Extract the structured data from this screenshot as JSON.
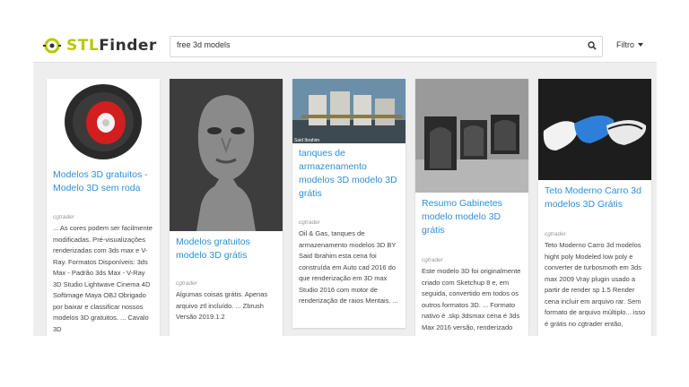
{
  "header": {
    "logo_prefix": "STL",
    "logo_suffix": "Finder",
    "search_value": "free 3d models",
    "filter_label": "Filtro"
  },
  "results": [
    {
      "title": "Modelos 3D gratuitos - Modelo 3D sem roda",
      "source": "cgtrader",
      "description": "... As cores podem ser facilmente modificadas. Pré-visualizações renderizadas com 3ds max e V-Ray. Formatos Disponíveis: 3ds Max - Padrão 3ds Max - V-Ray 3D Studio Lightwave Cinema 4D Softimage Maya OBJ Obrigado por baixar e classificar nossos modelos 3D gratuitos. ... Cavalo 3D"
    },
    {
      "title": "Modelos gratuitos modelo 3D grátis",
      "source": "cgtrader",
      "description": "Algumas coisas grátis. Apenas arquivo ztl incluído. ... Zbrush Versão 2019.1.2"
    },
    {
      "title": "tanques de armazenamento modelos 3D modelo 3D grátis",
      "source": "cgtrader",
      "image_caption": "Said Ibrahim",
      "description": "Oil & Gas, tanques de armazenamento modelos 3D BY Said Ibrahim esta cena foi construída em Auto cad 2016 do que renderização em 3D max Studio 2016 com motor de renderização de raios Mentais. ..."
    },
    {
      "title": "Resumo Gabinetes modelo modelo 3D grátis",
      "source": "cgtrader",
      "description": "Este modelo 3D foi originalmente criado com Sketchup 8 e, em seguida, convertido em todos os outros formatos 3D. ... Formato nativo é .skp 3dsmax cena é 3ds Max 2016 versão, renderizado com"
    },
    {
      "title": "Teto Moderno Carro 3d modelos 3D Grátis",
      "source": "cgtrader",
      "description": "Teto Moderno Carro 3d modelos hight poly Modeled low poly e converter de turbosmoth em 3ds max 2009 Vray plugin usado a partir de render sp 1.5 Render cena incluir em arquivo rar. Sem formato de arquivo múltiplo... isso é grátis no cgtrader então,"
    }
  ],
  "colors": {
    "title": "#2d8fd6",
    "logo_accent": "#b8c800",
    "background": "#eeeeef"
  }
}
